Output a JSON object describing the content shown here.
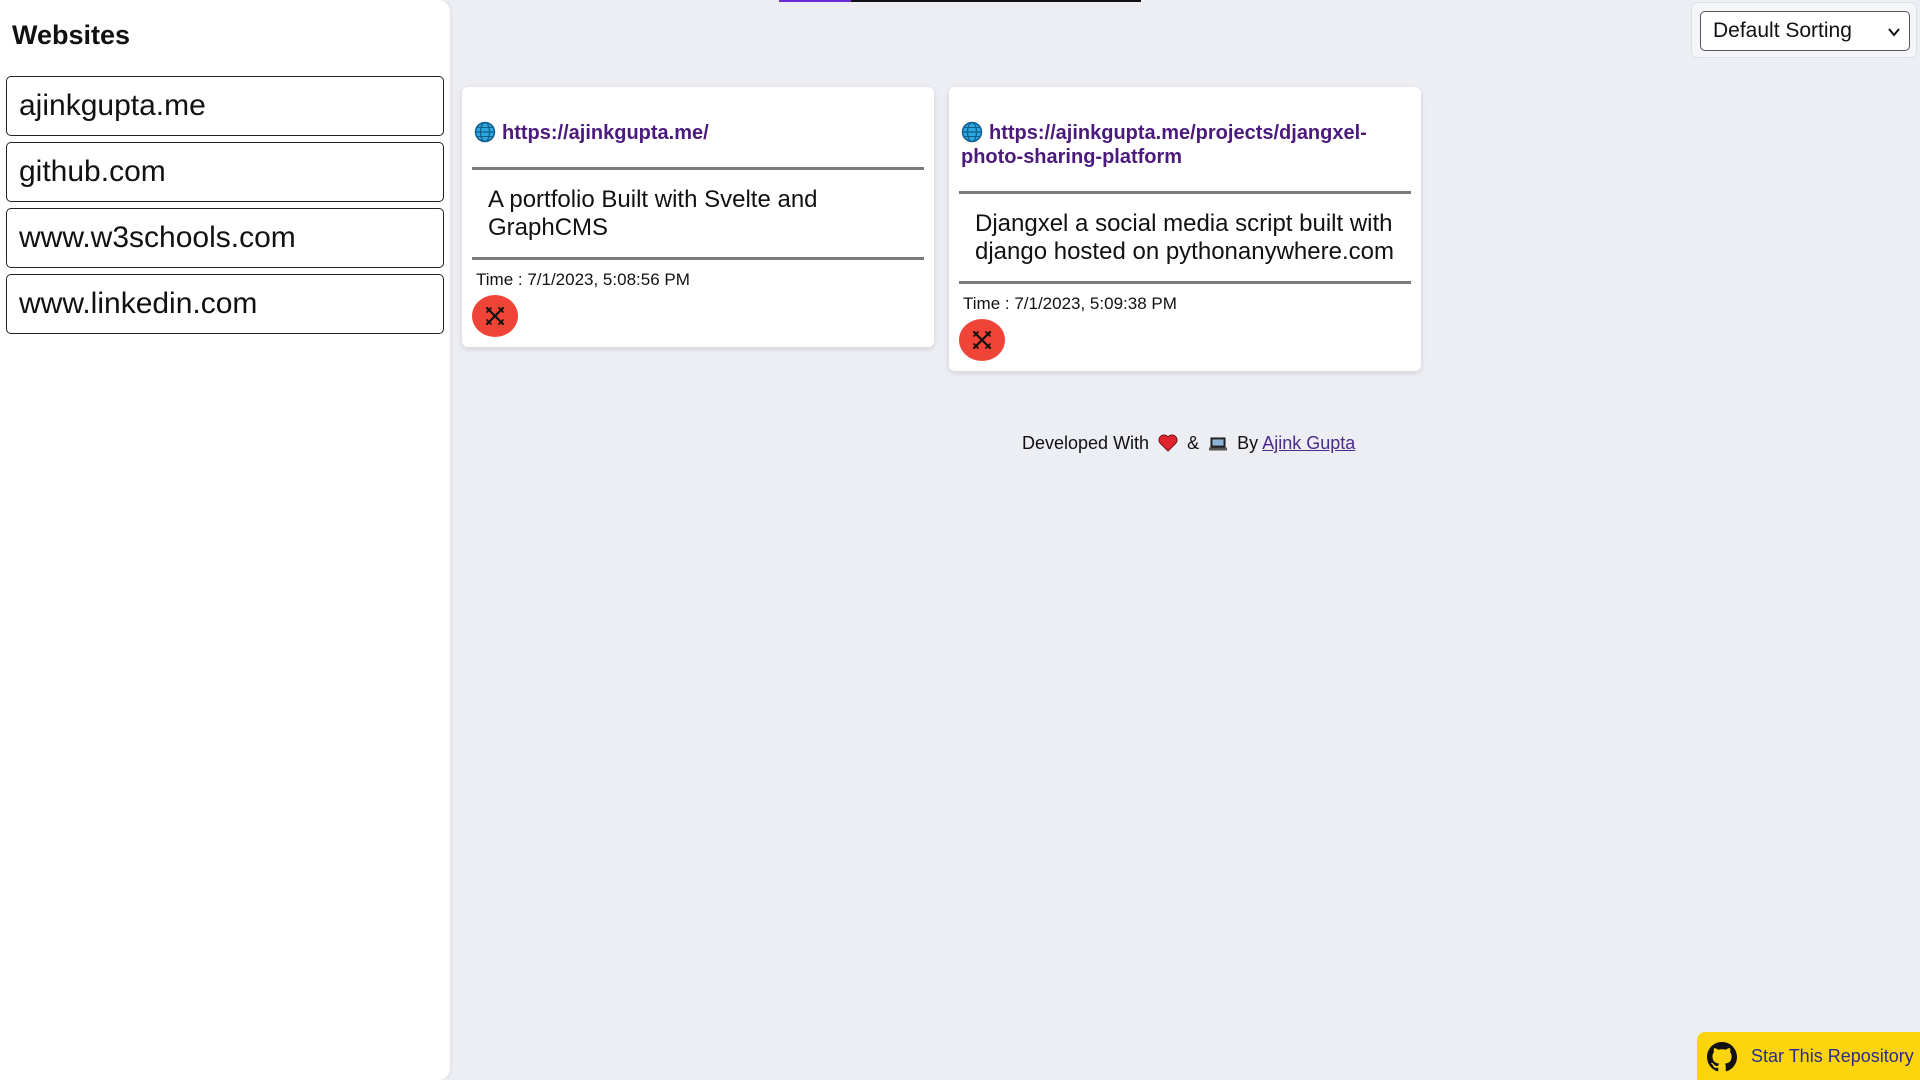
{
  "sidebar": {
    "title": "Websites",
    "items": [
      {
        "label": "ajinkgupta.me"
      },
      {
        "label": "github.com"
      },
      {
        "label": "www.w3schools.com"
      },
      {
        "label": "www.linkedin.com"
      }
    ]
  },
  "loading_progress": 0.2,
  "sort": {
    "selected": "Default Sorting"
  },
  "cards": [
    {
      "url": "https://ajinkgupta.me/",
      "description": "A portfolio Built with Svelte and GraphCMS",
      "time": "Time : 7/1/2023, 5:08:56 PM"
    },
    {
      "url": "https://ajinkgupta.me/projects/djangxel-photo-sharing-platform",
      "description": "Djangxel a social media script built with django hosted on pythonanywhere.com",
      "time": "Time : 7/1/2023, 5:09:38 PM"
    }
  ],
  "footer": {
    "prefix": "Developed With",
    "amp": "&",
    "by": "By",
    "author": "Ajink Gupta"
  },
  "star_repo": {
    "label": "Star This Repository",
    "icon": "github-icon"
  },
  "colors": {
    "background": "#eceef4",
    "link": "#4b1a7c",
    "delete": "#f04438",
    "star_banner": "#fbd40d",
    "progress": "#6a2ad6"
  }
}
